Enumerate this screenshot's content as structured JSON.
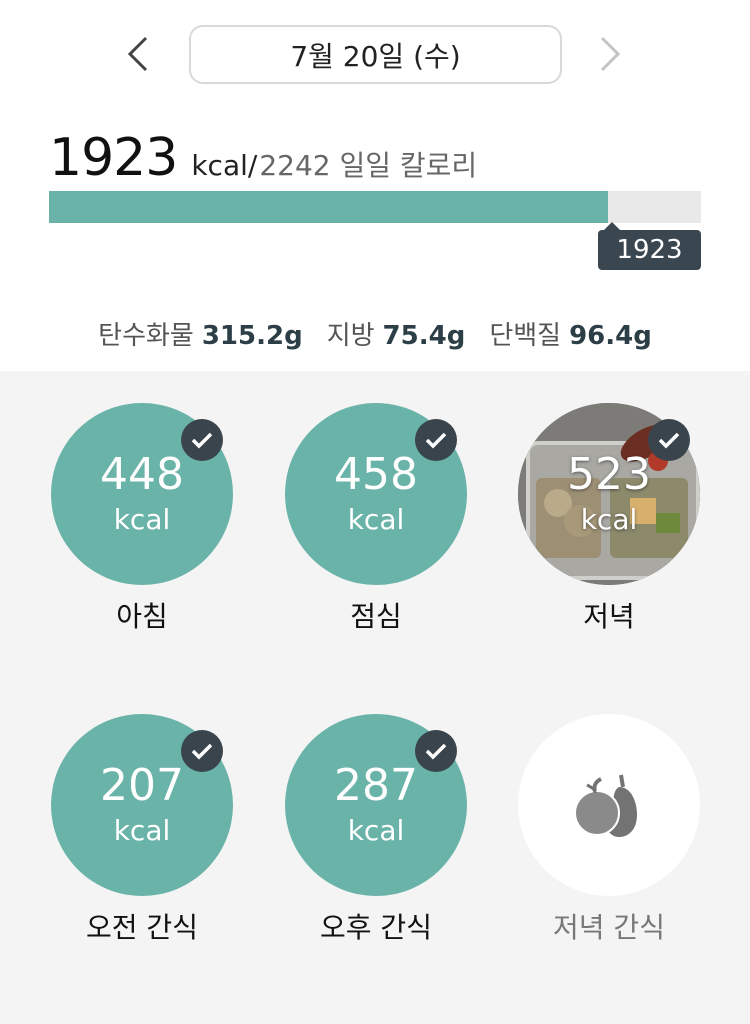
{
  "header": {
    "date": "7월 20일 (수)",
    "prev_icon": "chevron-left-icon",
    "next_icon": "chevron-right-icon"
  },
  "calories": {
    "consumed": "1923",
    "unit": "kcal/",
    "goal_text": "2242 일일 칼로리",
    "progress_fraction": 0.858,
    "tag": "1923"
  },
  "macros": [
    {
      "label": "탄수화물",
      "value": "315.2g"
    },
    {
      "label": "지방",
      "value": "75.4g"
    },
    {
      "label": "단백질",
      "value": "96.4g"
    }
  ],
  "meals": [
    {
      "name": "아침",
      "kcal": "448",
      "unit": "kcal",
      "checked": true
    },
    {
      "name": "점심",
      "kcal": "458",
      "unit": "kcal",
      "checked": true
    },
    {
      "name": "저녁",
      "kcal": "523",
      "unit": "kcal",
      "checked": true,
      "has_photo": true
    },
    {
      "name": "오전 간식",
      "kcal": "207",
      "unit": "kcal",
      "checked": true
    },
    {
      "name": "오후 간식",
      "kcal": "287",
      "unit": "kcal",
      "checked": true
    },
    {
      "name": "저녁 간식",
      "icon": "fruit-icon",
      "checked": false
    }
  ],
  "colors": {
    "accent": "#6ab3a8",
    "badge": "#3a444c",
    "track": "#e9e9e9"
  }
}
